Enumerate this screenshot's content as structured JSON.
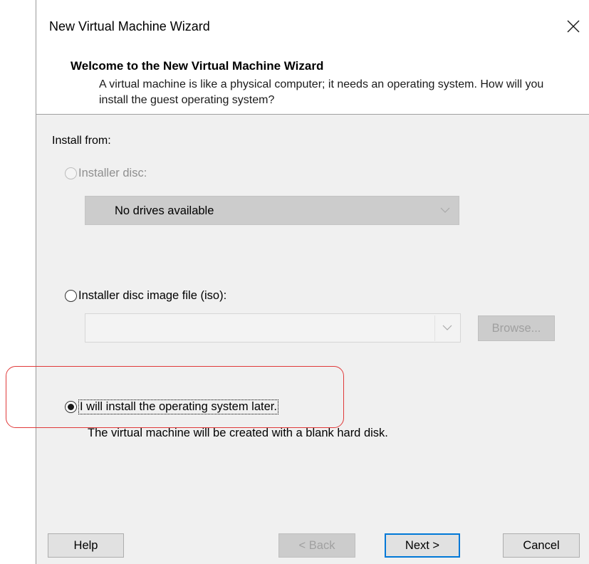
{
  "window": {
    "title": "New Virtual Machine Wizard",
    "close_glyph": "×"
  },
  "header": {
    "title": "Welcome to the New Virtual Machine Wizard",
    "description": "A virtual machine is like a physical computer; it needs an operating system. How will you install the guest operating system?"
  },
  "install": {
    "label": "Install from:",
    "option_disc": {
      "label": "Installer disc:",
      "selected": false,
      "enabled": false
    },
    "disc_combo": {
      "value": "No drives available",
      "enabled": false
    },
    "option_iso": {
      "label": "Installer disc image file (iso):",
      "selected": false,
      "enabled": true
    },
    "iso_combo": {
      "value": "",
      "enabled": false
    },
    "browse_label": "Browse...",
    "option_later": {
      "label": "I will install the operating system later.",
      "selected": true,
      "enabled": true
    },
    "later_description": "The virtual machine will be created with a blank hard disk."
  },
  "buttons": {
    "help": "Help",
    "back": "< Back",
    "next": "Next >",
    "cancel": "Cancel"
  },
  "colors": {
    "panel_bg": "#f0f0f0",
    "highlight": "#e03a3a",
    "default_button_border": "#0078d7"
  },
  "icons": {
    "close": "close-icon",
    "dropdown": "chevron-down-icon"
  }
}
